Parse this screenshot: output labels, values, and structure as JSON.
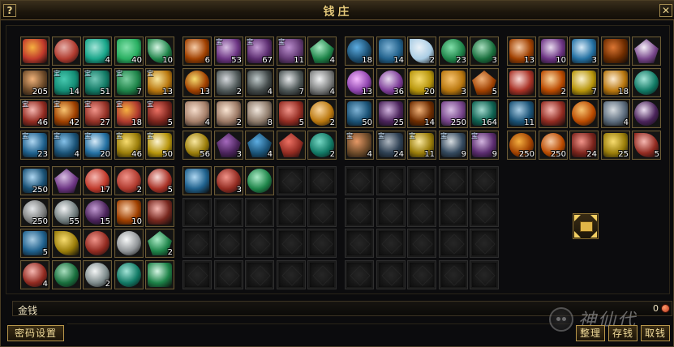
{
  "window": {
    "title": "钱庄",
    "help_icon": "question-icon",
    "close_icon": "close-icon",
    "help_label": "?",
    "close_label": "✕"
  },
  "bank": {
    "groups": [
      {
        "name": "group-1",
        "rows": [
          [
            {
              "c": "#c0392b",
              "c2": "#f5b041",
              "s": "sq"
            },
            {
              "c": "#b03a2e",
              "c2": "#e6b0aa",
              "s": "round"
            },
            {
              "c": "#17a589",
              "c2": "#a3e4d7",
              "s": "sq",
              "q": "4"
            },
            {
              "c": "#27ae60",
              "c2": "#82e0aa",
              "s": "sq",
              "q": "40"
            },
            {
              "c": "#1e8449",
              "c2": "#d5f5e3",
              "s": "leaf",
              "q": "10"
            }
          ],
          [
            {
              "c": "#6e4b2a",
              "c2": "#f0b27a",
              "s": "sq",
              "q": "205"
            },
            {
              "c": "#138d75",
              "c2": "#48c9b0",
              "s": "sq",
              "q": "14",
              "b": true
            },
            {
              "c": "#117a65",
              "c2": "#73c6b6",
              "s": "sq",
              "q": "51",
              "b": true
            },
            {
              "c": "#1e8449",
              "c2": "#7dcea0",
              "s": "sq",
              "q": "7",
              "b": true
            },
            {
              "c": "#b9770e",
              "c2": "#f9e79f",
              "s": "sq",
              "q": "13",
              "b": true
            }
          ],
          [
            {
              "c": "#922b21",
              "c2": "#f5b7b1",
              "s": "sq",
              "q": "46",
              "b": true
            },
            {
              "c": "#a04000",
              "c2": "#f8c471",
              "s": "sq",
              "q": "42",
              "b": true
            },
            {
              "c": "#943126",
              "c2": "#f1948a",
              "s": "sq",
              "q": "27",
              "b": true
            },
            {
              "c": "#b03a2e",
              "c2": "#f5b041",
              "s": "sq",
              "q": "18",
              "b": true
            },
            {
              "c": "#7b241c",
              "c2": "#ec7063",
              "s": "sq",
              "q": "5",
              "b": true
            }
          ],
          [
            {
              "c": "#1f618d",
              "c2": "#aed6f1",
              "s": "sq",
              "q": "23",
              "b": true
            },
            {
              "c": "#1a5276",
              "c2": "#85c1e9",
              "s": "sq",
              "q": "4",
              "b": true
            },
            {
              "c": "#2471a3",
              "c2": "#d6eaf8",
              "s": "sq",
              "q": "20",
              "b": true
            },
            {
              "c": "#9a7d0a",
              "c2": "#f7dc6f",
              "s": "sq",
              "q": "46",
              "b": true
            },
            {
              "c": "#b7950b",
              "c2": "#fcf3cf",
              "s": "sq",
              "q": "50",
              "b": true
            }
          ]
        ]
      },
      {
        "name": "group-2",
        "rows": [
          [
            {
              "c": "#a04000",
              "c2": "#f5cba7",
              "s": "sq",
              "q": "6"
            },
            {
              "c": "#6c3483",
              "c2": "#d7bde2",
              "s": "sq",
              "q": "53",
              "b": true
            },
            {
              "c": "#5b2c6f",
              "c2": "#c39bd3",
              "s": "sq",
              "q": "67",
              "b": true
            },
            {
              "c": "#633974",
              "c2": "#bb8fce",
              "s": "sq",
              "q": "11",
              "b": true
            },
            {
              "c": "#1d8348",
              "c2": "#abebc6",
              "s": "gem",
              "q": "4"
            }
          ],
          [
            {
              "c": "#a04000",
              "c2": "#f7dc6f",
              "s": "round",
              "q": "13"
            },
            {
              "c": "#515a5a",
              "c2": "#d5d8dc",
              "s": "sq",
              "q": "2"
            },
            {
              "c": "#424949",
              "c2": "#bfc9ca",
              "s": "sq",
              "q": "4"
            },
            {
              "c": "#4d5656",
              "c2": "#e5e7e9",
              "s": "sq",
              "q": "7"
            },
            {
              "c": "#7b7d7d",
              "c2": "#f2f3f4",
              "s": "sq",
              "q": "4"
            }
          ],
          [
            {
              "c": "#a6806a",
              "c2": "#f6ddcc",
              "s": "sq",
              "q": "4"
            },
            {
              "c": "#9c7a66",
              "c2": "#fae5d3",
              "s": "sq",
              "q": "2"
            },
            {
              "c": "#8e7b6b",
              "c2": "#f0e6dc",
              "s": "sq",
              "q": "8"
            },
            {
              "c": "#922b21",
              "c2": "#f1948a",
              "s": "sq",
              "q": "5"
            },
            {
              "c": "#b9770e",
              "c2": "#fad7a0",
              "s": "round",
              "q": "2"
            }
          ],
          [
            {
              "c": "#9a7d0a",
              "c2": "#f9e79f",
              "s": "round",
              "q": "56"
            },
            {
              "c": "#4a235a",
              "c2": "#a569bd",
              "s": "gem",
              "q": "3"
            },
            {
              "c": "#1a5276",
              "c2": "#5dade2",
              "s": "gem",
              "q": "4"
            },
            {
              "c": "#922b21",
              "c2": "#ec7063",
              "s": "gem",
              "q": ""
            },
            {
              "c": "#117864",
              "c2": "#76d7c4",
              "s": "round",
              "q": "2"
            }
          ]
        ]
      },
      {
        "name": "group-3",
        "rows": [
          [
            {
              "c": "#1b4f72",
              "c2": "#5dade2",
              "s": "round",
              "q": "18"
            },
            {
              "c": "#21618c",
              "c2": "#7fb3d5",
              "s": "sq",
              "q": "14"
            },
            {
              "c": "#a9cce3",
              "c2": "#eaf2f8",
              "s": "leaf",
              "q": "2"
            },
            {
              "c": "#1e8449",
              "c2": "#82e0aa",
              "s": "round",
              "q": "23"
            },
            {
              "c": "#196f3d",
              "c2": "#a9dfbf",
              "s": "round",
              "q": "3"
            }
          ],
          [
            {
              "c": "#8e44ad",
              "c2": "#f5b7ff",
              "s": "round",
              "q": "13"
            },
            {
              "c": "#7d3c98",
              "c2": "#e8daef",
              "s": "round",
              "q": "36"
            },
            {
              "c": "#b7950b",
              "c2": "#f7dc6f",
              "s": "sq",
              "q": "20"
            },
            {
              "c": "#b9770e",
              "c2": "#f8c471",
              "s": "sq",
              "q": "3"
            },
            {
              "c": "#a04000",
              "c2": "#f0b27a",
              "s": "gem",
              "q": "5"
            }
          ],
          [
            {
              "c": "#1a5276",
              "c2": "#7fb3d5",
              "s": "sq",
              "q": "50"
            },
            {
              "c": "#4a235a",
              "c2": "#d2b4de",
              "s": "sq",
              "q": "25"
            },
            {
              "c": "#6e2c00",
              "c2": "#f0b27a",
              "s": "sq",
              "q": "14"
            },
            {
              "c": "#76448a",
              "c2": "#d7bde2",
              "s": "sq",
              "q": "250"
            },
            {
              "c": "#0e6251",
              "c2": "#a2d9ce",
              "s": "sq",
              "q": "164"
            }
          ],
          [
            {
              "c": "#6e4b2a",
              "c2": "#e59866",
              "s": "sq",
              "q": "4",
              "b": true
            },
            {
              "c": "#2e4053",
              "c2": "#aeb6bf",
              "s": "sq",
              "q": "24",
              "b": true
            },
            {
              "c": "#9a7d0a",
              "c2": "#f9e79f",
              "s": "sq",
              "q": "11",
              "b": true
            },
            {
              "c": "#34495e",
              "c2": "#d6dbdf",
              "s": "sq",
              "q": "9",
              "b": true
            },
            {
              "c": "#5b2c6f",
              "c2": "#d2b4de",
              "s": "sq",
              "q": "9",
              "b": true
            }
          ]
        ]
      },
      {
        "name": "group-4",
        "rows": [
          [
            {
              "c": "#a04000",
              "c2": "#f5cba7",
              "s": "sq",
              "q": "13"
            },
            {
              "c": "#6c3483",
              "c2": "#e8daef",
              "s": "sq",
              "q": "10"
            },
            {
              "c": "#2471a3",
              "c2": "#d6eaf8",
              "s": "sq",
              "q": "3"
            },
            {
              "c": "#6e2c00",
              "c2": "#dc7633",
              "s": "sq",
              "q": ""
            },
            {
              "c": "#76448a",
              "c2": "#f5eef8",
              "s": "gem",
              "q": ""
            }
          ],
          [
            {
              "c": "#a93226",
              "c2": "#fadbd8",
              "s": "sq",
              "q": ""
            },
            {
              "c": "#ba4a00",
              "c2": "#fad7a0",
              "s": "sq",
              "q": "2"
            },
            {
              "c": "#b7950b",
              "c2": "#fcf3cf",
              "s": "sq",
              "q": "7"
            },
            {
              "c": "#b9770e",
              "c2": "#fdebd0",
              "s": "sq",
              "q": "18"
            },
            {
              "c": "#117a65",
              "c2": "#a3e4d7",
              "s": "round",
              "q": ""
            }
          ],
          [
            {
              "c": "#1a5276",
              "c2": "#a9cce3",
              "s": "sq",
              "q": "11"
            },
            {
              "c": "#922b21",
              "c2": "#f5b7b1",
              "s": "sq",
              "q": ""
            },
            {
              "c": "#ba4a00",
              "c2": "#f8c471",
              "s": "round",
              "q": ""
            },
            {
              "c": "#5d6d7e",
              "c2": "#d6dbdf",
              "s": "sq",
              "q": "4"
            },
            {
              "c": "#4a235a",
              "c2": "#ebdef0",
              "s": "round",
              "q": ""
            }
          ],
          [
            {
              "c": "#a04000",
              "c2": "#f5b041",
              "s": "round",
              "q": "250"
            },
            {
              "c": "#ba4a00",
              "c2": "#f5cba7",
              "s": "round",
              "q": "250"
            },
            {
              "c": "#7b241c",
              "c2": "#f1948a",
              "s": "sq",
              "q": "24"
            },
            {
              "c": "#9a7d0a",
              "c2": "#f7dc6f",
              "s": "sq",
              "q": "25"
            },
            {
              "c": "#922b21",
              "c2": "#f5b7b1",
              "s": "leaf",
              "q": "5"
            }
          ]
        ]
      },
      {
        "name": "group-5",
        "rows": [
          [
            {
              "c": "#1a5276",
              "c2": "#aed6f1",
              "s": "sq",
              "q": "250"
            },
            {
              "c": "#6c3483",
              "c2": "#d7bde2",
              "s": "gem",
              "q": ""
            },
            {
              "c": "#c0392b",
              "c2": "#f5b7b1",
              "s": "round",
              "q": "17"
            },
            {
              "c": "#b03a2e",
              "c2": "#f1948a",
              "s": "round",
              "q": "2"
            },
            {
              "c": "#a93226",
              "c2": "#fadbd8",
              "s": "round",
              "q": "5"
            }
          ],
          [
            {
              "c": "#7b7d7d",
              "c2": "#e5e7e9",
              "s": "round",
              "q": "250"
            },
            {
              "c": "#717d7e",
              "c2": "#f2f3f4",
              "s": "round",
              "q": "55"
            },
            {
              "c": "#4a235a",
              "c2": "#c39bd3",
              "s": "round",
              "q": "15"
            },
            {
              "c": "#a04000",
              "c2": "#f5cba7",
              "s": "sq",
              "q": "10"
            },
            {
              "c": "#78281f",
              "c2": "#f5b7b1",
              "s": "sq",
              "q": ""
            }
          ],
          [
            {
              "c": "#1f618d",
              "c2": "#a9cce3",
              "s": "sq",
              "q": "5"
            },
            {
              "c": "#9a7d0a",
              "c2": "#f7dc6f",
              "s": "leaf",
              "q": ""
            },
            {
              "c": "#922b21",
              "c2": "#f1948a",
              "s": "round",
              "q": ""
            },
            {
              "c": "#909497",
              "c2": "#f8f9f9",
              "s": "round",
              "q": ""
            },
            {
              "c": "#1e8449",
              "c2": "#abebc6",
              "s": "gem",
              "q": "2"
            }
          ],
          [
            {
              "c": "#922b21",
              "c2": "#f5b7b1",
              "s": "round",
              "q": "4"
            },
            {
              "c": "#196f3d",
              "c2": "#a9dfbf",
              "s": "round",
              "q": ""
            },
            {
              "c": "#7f8c8d",
              "c2": "#f4f6f6",
              "s": "round",
              "q": "2"
            },
            {
              "c": "#117a65",
              "c2": "#a3e4d7",
              "s": "round",
              "q": ""
            },
            {
              "c": "#1d8348",
              "c2": "#d5f5e3",
              "s": "sq",
              "q": ""
            }
          ]
        ]
      },
      {
        "name": "group-6",
        "rows": [
          [
            {
              "c": "#1f618d",
              "c2": "#aed6f1",
              "s": "sq",
              "q": ""
            },
            {
              "c": "#922b21",
              "c2": "#f1948a",
              "s": "round",
              "q": "3"
            },
            {
              "c": "#1e8449",
              "c2": "#abebc6",
              "s": "round",
              "q": ""
            },
            null,
            null
          ],
          [
            null,
            null,
            null,
            null,
            null
          ],
          [
            null,
            null,
            null,
            null,
            null
          ],
          [
            null,
            null,
            null,
            null,
            null
          ]
        ]
      },
      {
        "name": "group-7",
        "rows": [
          [
            null,
            null,
            null,
            null,
            null
          ],
          [
            null,
            null,
            null,
            null,
            null
          ],
          [
            null,
            null,
            null,
            null,
            null
          ],
          [
            null,
            null,
            null,
            null,
            null
          ]
        ]
      }
    ],
    "bound_tag": "宝"
  },
  "chest_icon": "bank-bag-icon",
  "money": {
    "label": "金钱",
    "value": "0",
    "icon": "coin-icon"
  },
  "buttons": {
    "password": "密码设置",
    "sort": "整理",
    "deposit": "存钱",
    "withdraw": "取钱"
  },
  "logo": {
    "text": "神仙代",
    "icon": "mascot-icon"
  }
}
